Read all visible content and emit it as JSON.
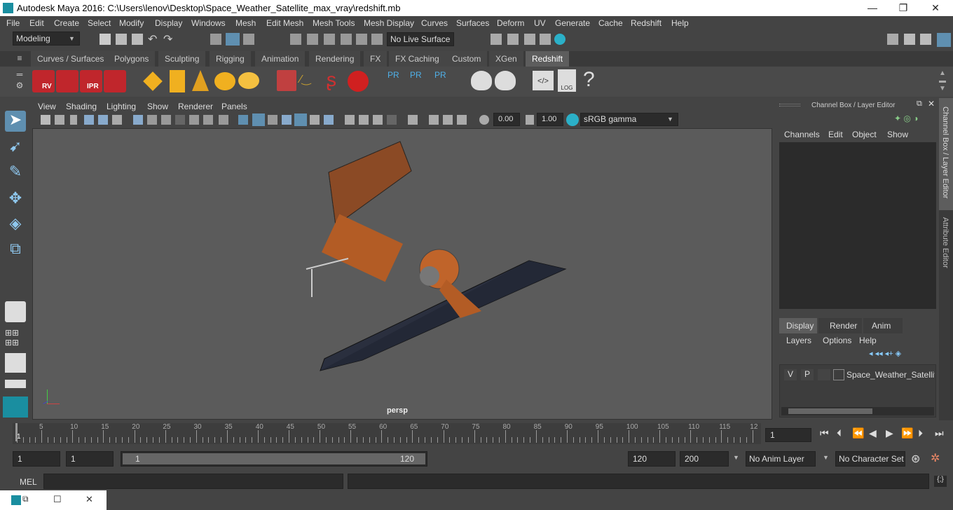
{
  "window": {
    "title": "Autodesk Maya 2016: C:\\Users\\lenov\\Desktop\\Space_Weather_Satellite_max_vray\\redshift.mb",
    "min": "—",
    "max": "❐",
    "close": "✕"
  },
  "menubar": [
    "File",
    "Edit",
    "Create",
    "Select",
    "Modify",
    "Display",
    "Windows",
    "Mesh",
    "Edit Mesh",
    "Mesh Tools",
    "Mesh Display",
    "Curves",
    "Surfaces",
    "Deform",
    "UV",
    "Generate",
    "Cache",
    "Redshift",
    "Help"
  ],
  "statusline": {
    "mode": "Modeling",
    "live": "No Live Surface"
  },
  "shelf_tabs": [
    "Curves / Surfaces",
    "Polygons",
    "Sculpting",
    "Rigging",
    "Animation",
    "Rendering",
    "FX",
    "FX Caching",
    "Custom",
    "XGen",
    "Redshift"
  ],
  "active_shelf": "Redshift",
  "shelf": {
    "rv": "RV",
    "ipr": "IPR",
    "pr": "PR",
    "log": "LOG",
    "help": "?"
  },
  "panel_menu": [
    "View",
    "Shading",
    "Lighting",
    "Show",
    "Renderer",
    "Panels"
  ],
  "panel_toolbar": {
    "exposure": "0.00",
    "gamma": "1.00",
    "colorspace": "sRGB gamma"
  },
  "viewport": {
    "camera": "persp"
  },
  "channel_box": {
    "title": "Channel Box / Layer Editor",
    "menu": [
      "Channels",
      "Edit",
      "Object",
      "Show"
    ],
    "tabs": [
      "Display",
      "Render",
      "Anim"
    ],
    "layer_menu": [
      "Layers",
      "Options",
      "Help"
    ],
    "layer": {
      "v": "V",
      "p": "P",
      "name": "Space_Weather_Satellite"
    }
  },
  "side_tabs": [
    "Channel Box / Layer Editor",
    "Attribute Editor"
  ],
  "timeline": {
    "ticks": [
      "5",
      "10",
      "15",
      "20",
      "25",
      "30",
      "35",
      "40",
      "45",
      "50",
      "55",
      "60",
      "65",
      "70",
      "75",
      "80",
      "85",
      "90",
      "95",
      "100",
      "105",
      "110",
      "115",
      "12"
    ],
    "current_marker": "1",
    "current_frame": "1"
  },
  "range": {
    "start": "1",
    "playstart": "1",
    "slider_start": "1",
    "slider_end": "120",
    "playend": "120",
    "end": "200",
    "anim_layer": "No Anim Layer",
    "char_set": "No Character Set"
  },
  "mel": {
    "label": "MEL"
  },
  "colors": {
    "accent": "#5d5d5d",
    "redshift": "#c0262c",
    "viewport": "#5b5b5b"
  }
}
